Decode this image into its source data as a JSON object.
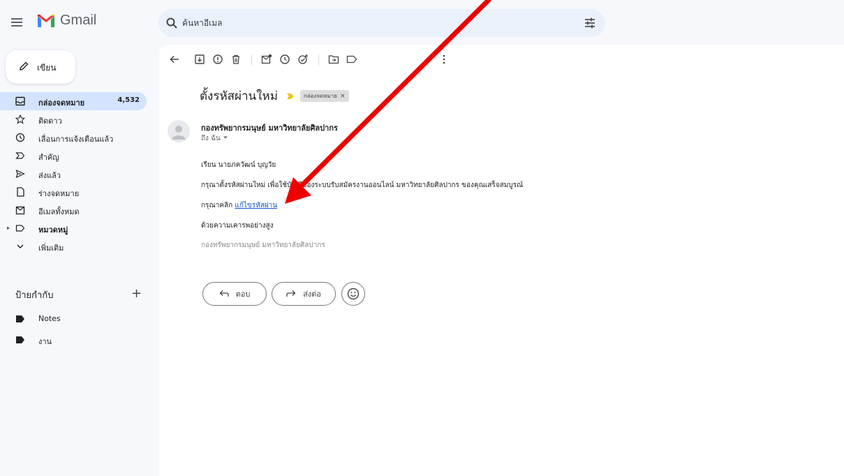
{
  "app": {
    "name": "Gmail"
  },
  "search": {
    "placeholder": "ค้นหาอีเมล"
  },
  "compose": {
    "label": "เขียน"
  },
  "nav": [
    {
      "label": "กล่องจดหมาย",
      "count": "4,532",
      "icon": "inbox-icon",
      "active": true
    },
    {
      "label": "ติดดาว",
      "icon": "star-icon"
    },
    {
      "label": "เลื่อนการแจ้งเตือนแล้ว",
      "icon": "snooze-clock-icon"
    },
    {
      "label": "สำคัญ",
      "icon": "important-icon"
    },
    {
      "label": "ส่งแล้ว",
      "icon": "send-icon"
    },
    {
      "label": "ร่างจดหมาย",
      "icon": "draft-icon"
    },
    {
      "label": "อีเมลทั้งหมด",
      "icon": "all-mail-icon"
    },
    {
      "label": "หมวดหมู่",
      "icon": "label-icon",
      "bold": true
    },
    {
      "label": "เพิ่มเติม",
      "icon": "chevron-down-icon"
    }
  ],
  "labels": {
    "title": "ป้ายกำกับ",
    "add_symbol": "+",
    "items": [
      {
        "label": "Notes",
        "icon": "label-tag-icon"
      },
      {
        "label": "งาน",
        "icon": "label-tag-icon"
      }
    ]
  },
  "email": {
    "subject": "ตั้งรหัสผ่านใหม่",
    "tag": "กล่องจดหมาย",
    "tag_close": "×",
    "sender": "กองทรัพยากรมนุษย์ มหาวิทยาลัยศิลปากร",
    "to": "ถึง ฉัน",
    "body": {
      "greeting": "เรียน นายภควัฒน์ บุญวัย",
      "line1": "กรุณาตั้งรหัสผ่านใหม่ เพื่อใช้บัญชีของระบบรับสมัครงานออนไลน์ มหาวิทยาลัยศิลปากร ของคุณเสร็จสมบูรณ์",
      "click_prefix": "กรุณาคลิก",
      "link_text": "แก้ไขรหัสผ่าน",
      "closing": "ด้วยความเคารพอย่างสูง",
      "signature": "กองทรัพยากรมนุษย์ มหาวิทยาลัยศิลปากร"
    },
    "actions": {
      "reply": "ตอบ",
      "forward": "ส่งต่อ"
    }
  },
  "colors": {
    "background": "#f6f8fc",
    "active_nav": "#d3e3fd",
    "search_bg": "#eaf1fb",
    "link": "#1155cc",
    "annotation_arrow": "#ee0000",
    "important_marker": "#f2c31b"
  }
}
